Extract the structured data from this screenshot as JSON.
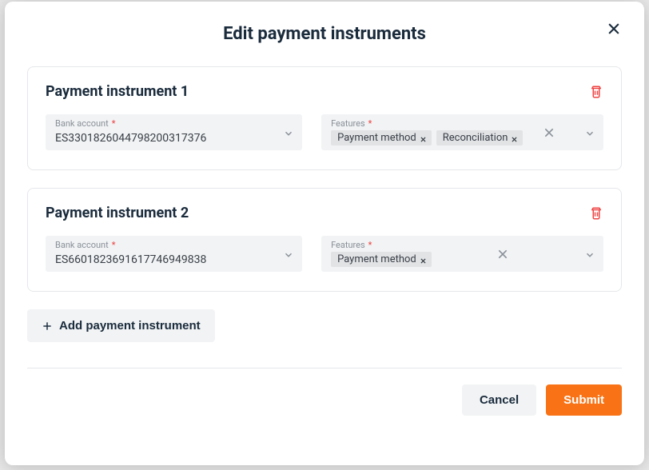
{
  "modal": {
    "title": "Edit payment instruments",
    "add_label": "Add payment instrument",
    "cancel_label": "Cancel",
    "submit_label": "Submit"
  },
  "labels": {
    "bank_account": "Bank account",
    "features": "Features",
    "required_mark": "*"
  },
  "instruments": [
    {
      "title": "Payment instrument 1",
      "bank_account": "ES3301826044798200317376",
      "features": [
        "Payment method",
        "Reconciliation"
      ]
    },
    {
      "title": "Payment instrument 2",
      "bank_account": "ES6601823691617746949838",
      "features": [
        "Payment method"
      ]
    }
  ]
}
